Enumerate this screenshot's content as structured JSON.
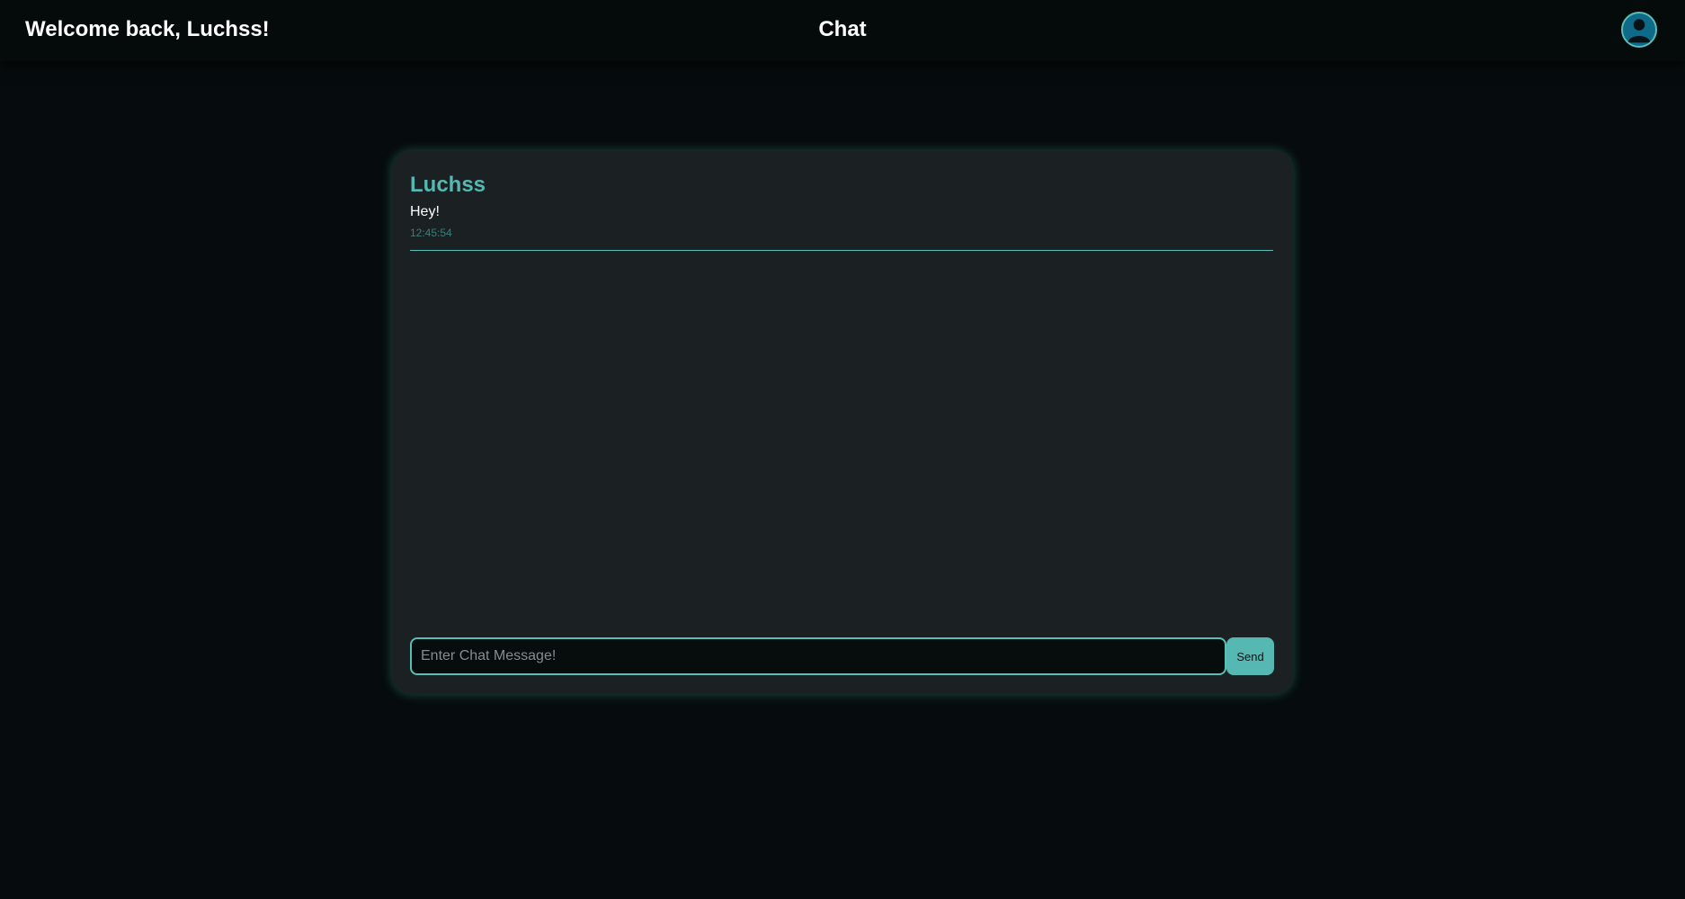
{
  "header": {
    "welcome_text": "Welcome back, Luchss!",
    "title": "Chat",
    "avatar_icon": "user-avatar-icon"
  },
  "chat": {
    "messages": [
      {
        "user": "Luchss",
        "text": "Hey!",
        "time": "12:45:54"
      }
    ],
    "input_placeholder": "Enter Chat Message!",
    "input_value": "",
    "send_label": "Send"
  },
  "colors": {
    "accent": "#55b8b2",
    "background": "#060c0d",
    "card": "#1b2122"
  }
}
